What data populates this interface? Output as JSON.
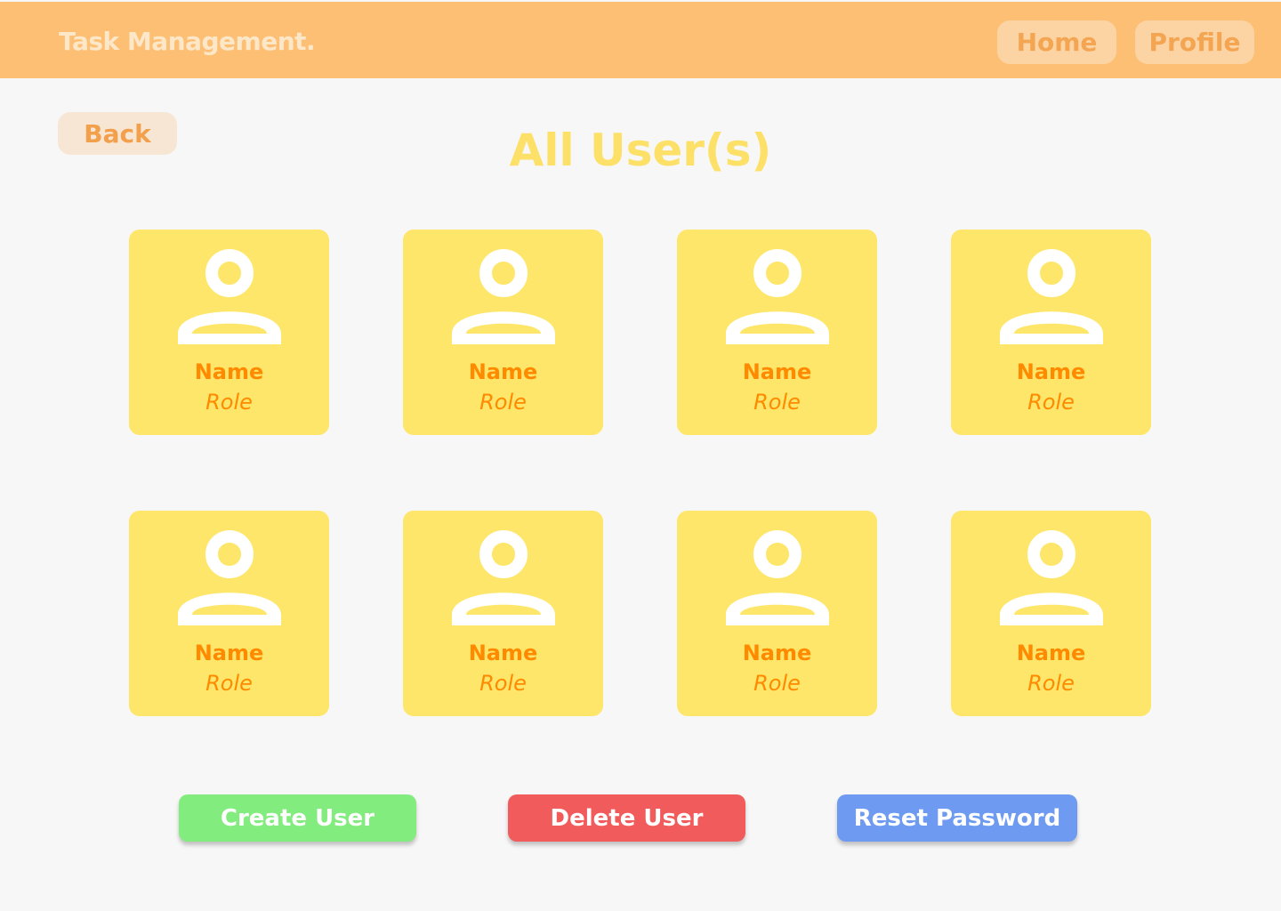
{
  "header": {
    "brand": "Task Management.",
    "nav": {
      "home_label": "Home",
      "profile_label": "Profile"
    }
  },
  "back_label": "Back",
  "page_title": "All User(s)",
  "users": [
    {
      "name": "Name",
      "role": "Role"
    },
    {
      "name": "Name",
      "role": "Role"
    },
    {
      "name": "Name",
      "role": "Role"
    },
    {
      "name": "Name",
      "role": "Role"
    },
    {
      "name": "Name",
      "role": "Role"
    },
    {
      "name": "Name",
      "role": "Role"
    },
    {
      "name": "Name",
      "role": "Role"
    },
    {
      "name": "Name",
      "role": "Role"
    }
  ],
  "actions": {
    "create_label": "Create User",
    "delete_label": "Delete User",
    "reset_label": "Reset Password"
  },
  "icons": {
    "avatar": "user-icon"
  },
  "colors": {
    "header_bg": "#fdbf73",
    "card_bg": "#fee66a",
    "card_text": "#ff8a00",
    "title": "#fde068",
    "create": "#82ec7e",
    "delete": "#f25b5b",
    "reset": "#6e9bf1"
  }
}
